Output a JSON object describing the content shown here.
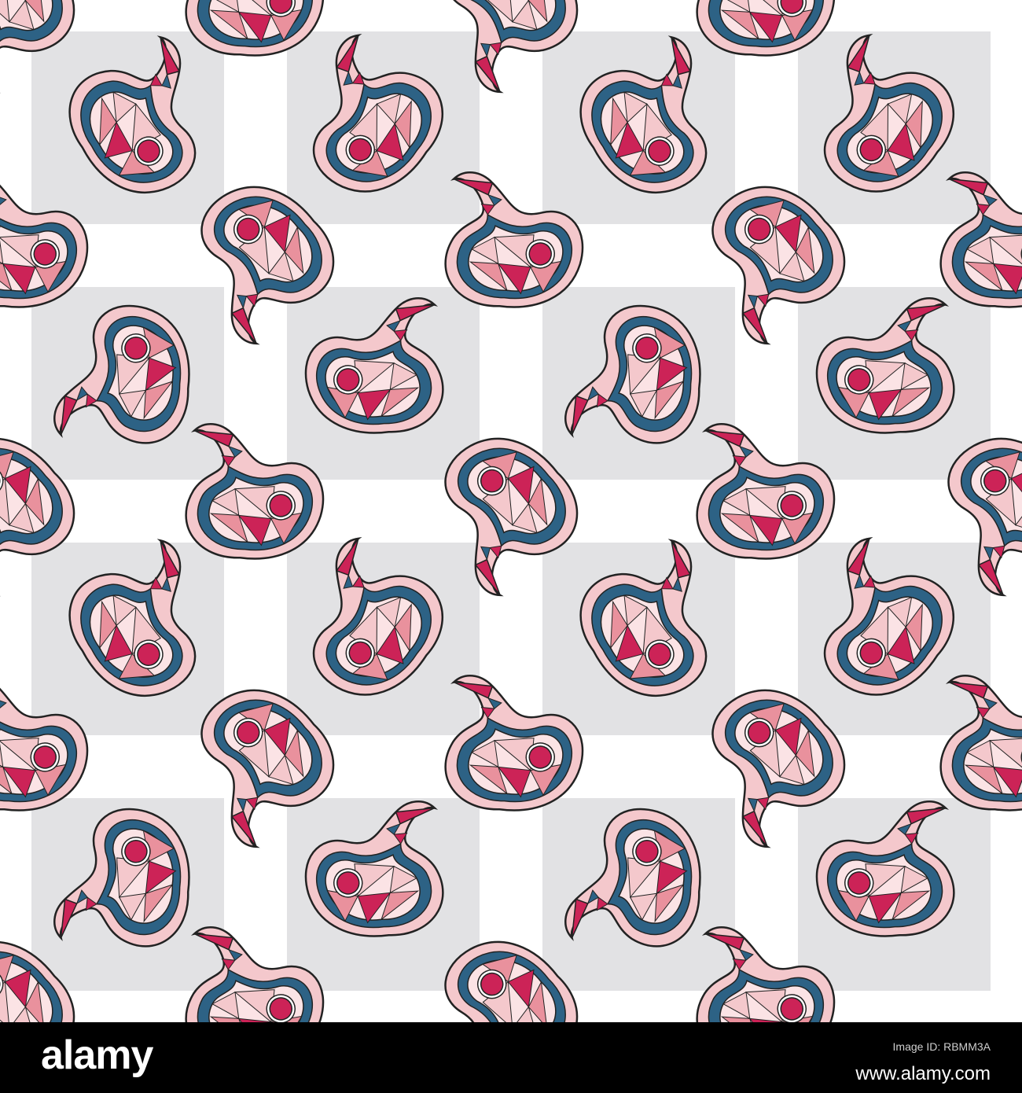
{
  "image": {
    "description_free": true,
    "palette": {
      "background": "#ffffff",
      "grid_gray": "#e2e2e4",
      "magenta": "#cc2357",
      "pink_light": "#f4c8cc",
      "pink_mid": "#e9919d",
      "pink_pale": "#fbe3e5",
      "teal": "#2d6285",
      "outline": "#222222"
    }
  },
  "footer": {
    "brand": "alamy",
    "ref_label": "Image ID: RBMM3A",
    "ref_code": "www.alamy.com"
  },
  "icons": {
    "motif": "paisley-icon"
  }
}
